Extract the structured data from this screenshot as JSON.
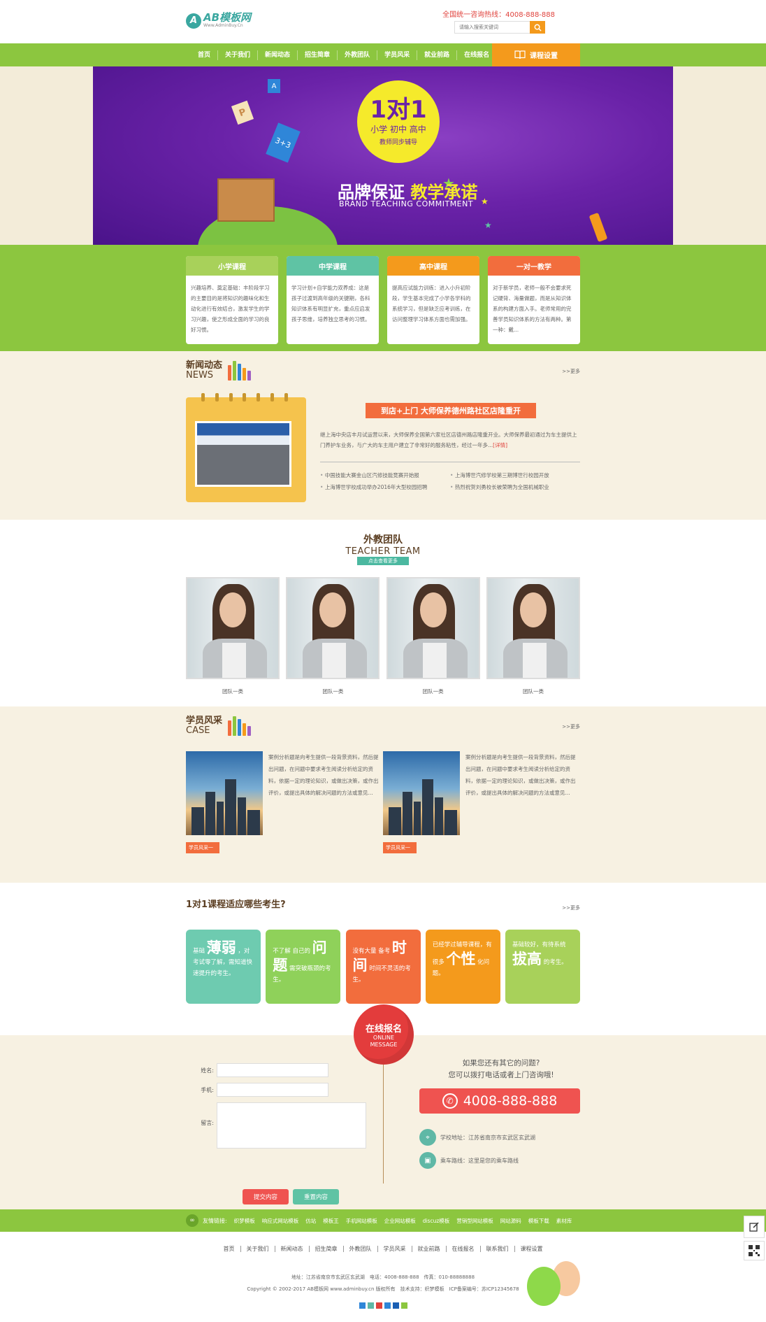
{
  "header": {
    "logo_mark": "A",
    "logo_name": "AB模板网",
    "logo_sub": "Www.AdminBuy.Cn",
    "hotline": "全国统一咨询热线：4008-888-888",
    "search_placeholder": "请输入搜索关键词"
  },
  "nav": {
    "items": [
      "首页",
      "关于我们",
      "新闻动态",
      "招生简章",
      "外教团队",
      "学员风采",
      "就业前路",
      "在线报名"
    ],
    "special": "课程设置"
  },
  "banner": {
    "big": "1对1",
    "line2": "小学 初中 高中",
    "line3": "教师同步辅导",
    "brand_a": "品牌保证",
    "brand_b": "教学承诺",
    "brand_en": "BRAND TEACHING COMMITMENT",
    "card_p": "P",
    "card_a": "A",
    "ruler": "3+3"
  },
  "courses": [
    {
      "title": "小学课程",
      "color": "#a8d15a",
      "desc": "兴趣培养、奠定基础：丰阶段学习的主要目的是将知识的趣味化和生动化进行有效结合，激发学生的学习兴趣，使之形成全面的学习的良好习惯。"
    },
    {
      "title": "中学课程",
      "color": "#5fc3a4",
      "desc": "学习计划+自学能力双养成：这是孩子过渡到高年级的关键期，各科知识体系有明显扩充，重点应启发孩子思维，培养独立思考的习惯。"
    },
    {
      "title": "高中课程",
      "color": "#f49a1c",
      "desc": "提高应试能力训练：进入小升初阶段，学生基本完成了小学各学科的系统学习，但是缺乏应考训练，在访问整理学习体系方面也需加强。"
    },
    {
      "title": "一对一教学",
      "color": "#f26d3d",
      "desc": "对于新学员，老师一般不会要求死记硬背、海量做题，而是从知识体系的构建方面入手。老师常用的完善学员知识体系的方法有两种。第一种：戴..."
    }
  ],
  "news": {
    "title_cn": "新闻动态",
    "title_en": "NEWS",
    "more": ">>更多",
    "headline": "到店+上门 大师保养德州路社区店隆重开",
    "desc": "继上海中央店丰月试运营以来，大师保养全国第六家社区店德州路店隆重开业。大师保养最初通过为车主提供上门养护车业务，与广大的车主用户建立了非常好的服务粘性，经过一年多...",
    "detail": "[详情]",
    "list": [
      "中国技能大赛金山区汽修技能竞赛开始报",
      "上海博世汽修学校第三期博世行校园开放",
      "上海博世学校成功举办2016年大型校园招聘",
      "热烈祝贺刘勇校长被荣聘为全国机械职业"
    ]
  },
  "teachers": {
    "title_cn": "外教团队",
    "title_en": "TEACHER TEAM",
    "click": "点击查看更多",
    "items": [
      {
        "name": "团队一类"
      },
      {
        "name": "团队一类"
      },
      {
        "name": "团队一类"
      },
      {
        "name": "团队一类"
      }
    ]
  },
  "cases": {
    "title_cn": "学员风采",
    "title_en": "CASE",
    "more": ">>更多",
    "items": [
      {
        "text": "案例分析题是向考生提供一段背景资料，然后提出问题，在问题中要求考生阅读分析给定的资料，依据一定的理论知识，或做出决策，或作出评价，或提出具体的解决问题的方法或意见...",
        "tag": "学员风采一"
      },
      {
        "text": "案例分析题是向考生提供一段背景资料，然后提出问题，在问题中要求考生阅读分析给定的资料，依据一定的理论知识，或做出决策，或作出评价，或提出具体的解决问题的方法或意见...",
        "tag": "学员风采一"
      }
    ]
  },
  "suit": {
    "title": "1对1课程适应哪些考生?",
    "more": ">>更多",
    "items": [
      {
        "pre": "基础",
        "big": "薄弱",
        "post": "，对考试零了解，需知道快速提升的考生。",
        "color": "#6ecbb0"
      },
      {
        "pre": "不了解 自己的",
        "big": "问题",
        "post": "需突破瓶颈的考生。",
        "color": "#8fd15a"
      },
      {
        "pre": "没有大量 备考",
        "big": "时间",
        "post": "时间不灵活的考生。",
        "color": "#f26d3d"
      },
      {
        "pre": "已经学过辅导课程，有很多",
        "big": "个性",
        "post": "化问题。",
        "color": "#f49a1c"
      },
      {
        "pre": "基础较好，有待系统",
        "big": "拔高",
        "post": "的考生。",
        "color": "#a8d15a"
      }
    ]
  },
  "contact": {
    "balloon_cn": "在线报名",
    "balloon_en1": "ONLINE",
    "balloon_en2": "MESSAGE",
    "name_label": "姓名:",
    "phone_label": "手机:",
    "msg_label": "留言:",
    "submit": "提交内容",
    "reset": "重置内容",
    "ask1": "如果您还有其它的问题?",
    "ask2": "您可以拨打电话或者上门咨询哦!",
    "phone": "4008-888-888",
    "address": "学校地址：江苏省南京市玄武区玄武湖",
    "route": "乘车路线：这里是您的乘车路线"
  },
  "links": {
    "label": "友情链接:",
    "items": [
      "织梦模板",
      "响应式网站模板",
      "仿站",
      "模板王",
      "手机网站模板",
      "企业网站模板",
      "discuz模板",
      "营销型网站模板",
      "网站源码",
      "模板下载",
      "素材库"
    ]
  },
  "footer": {
    "nav": [
      "首页",
      "关于我们",
      "新闻动态",
      "招生简章",
      "外教团队",
      "学员风采",
      "就业前路",
      "在线报名",
      "联系我们",
      "课程设置"
    ],
    "line1": "地址：江苏省南京市玄武区玄武湖　电话：4008-888-888　传真：010-88888888",
    "line2": "Copyright © 2002-2017 AB模板网 www.adminbuy.cn 版权所有　技术支持：织梦模板　ICP备案编号：苏ICP12345678"
  },
  "colors": {
    "green": "#8cc63f",
    "orange": "#f49a1c",
    "red": "#ef5350",
    "teal": "#5fc3a4"
  }
}
